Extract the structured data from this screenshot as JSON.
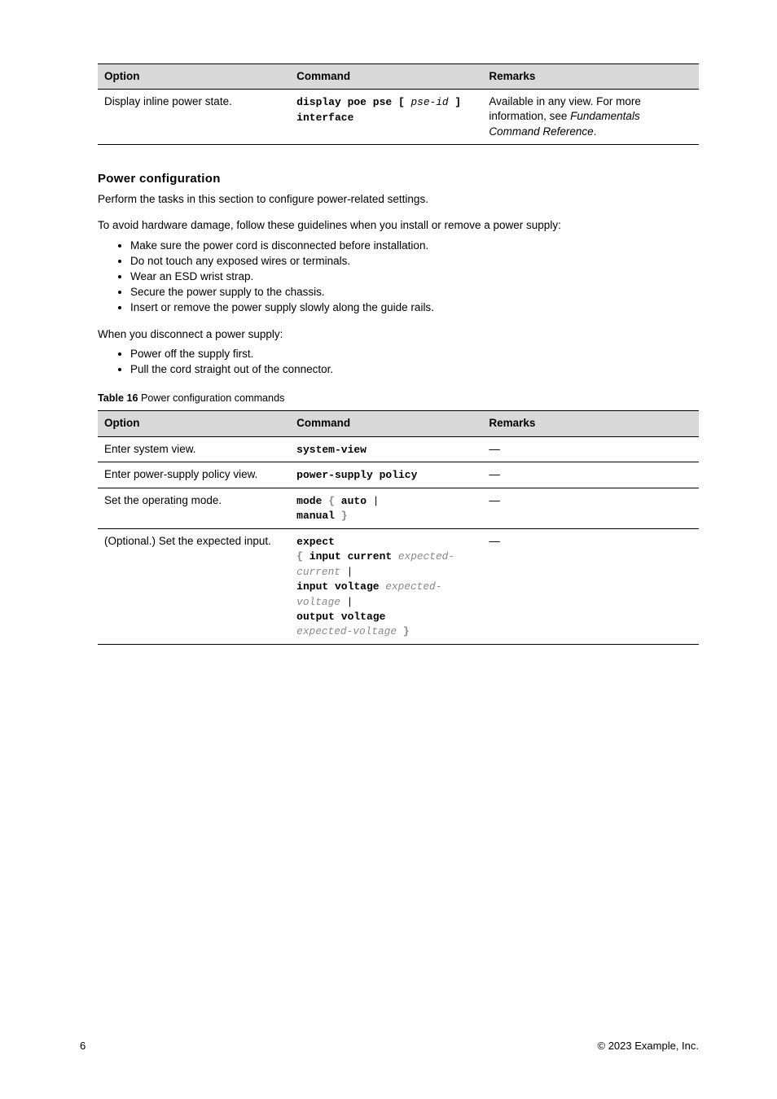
{
  "table1": {
    "headers": {
      "opt": "Option",
      "cmd": "Command",
      "rem": "Remarks"
    },
    "row": {
      "opt": "Display inline power state.",
      "cmd_pre": "display poe pse ",
      "cmd_b1": "[",
      "cmd_mid": " pse-id ",
      "cmd_b2": "]",
      "cmd_post": " interface",
      "rem_pre": "Available in any view. For more information, see ",
      "rem_it": "Fundamentals Command Reference",
      "rem_post": "."
    }
  },
  "section": {
    "heading": "Power configuration",
    "desc": "Perform the tasks in this section to configure power-related settings.",
    "sub1": "To avoid hardware damage, follow these guidelines when you install or remove a power supply:",
    "bullets1": [
      "Make sure the power cord is disconnected before installation.",
      "Do not touch any exposed wires or terminals.",
      "Wear an ESD wrist strap.",
      "Secure the power supply to the chassis.",
      "Insert or remove the power supply slowly along the guide rails."
    ],
    "sub2": "When you disconnect a power supply:",
    "bullets2": [
      "Power off the supply first.",
      "Pull the cord straight out of the connector."
    ]
  },
  "table2": {
    "caption_b": "Table 16",
    "caption_rest": " Power configuration commands",
    "headers": {
      "opt": "Option",
      "cmd": "Command",
      "rem": "Remarks"
    },
    "rows": [
      {
        "opt": "Enter system view.",
        "cmd": "system-view",
        "rem": "—"
      },
      {
        "opt": "Enter power-supply policy view.",
        "cmd": "power-supply policy",
        "rem": "—"
      },
      {
        "opt": "Set the operating mode.",
        "cmd_pre": "mode ",
        "cmd_b1": "{ ",
        "cmd_o1": "auto",
        "cmd_p1": " | ",
        "cmd_o2": "manual",
        "cmd_b2": " }",
        "rem": "—"
      },
      {
        "opt": "(Optional.) Set the expected input.",
        "cmd_pre": "expect",
        "cmd_ln2_pre": " ",
        "cmd_ln2_b1": "{ ",
        "cmd_ln2_a": "input current",
        "cmd_ln2_it1": " expected-current ",
        "cmd_ln2_p": "|",
        "cmd_ln3_a": " input voltage",
        "cmd_ln3_it": " expected-voltage",
        "cmd_ln3_p": " |",
        "cmd_ln4_a": " output voltage",
        "cmd_ln5_it": " expected-voltage ",
        "cmd_ln5_b2": "}",
        "rem": "—"
      }
    ]
  },
  "footer": {
    "left": "6",
    "right": "© 2023 Example, Inc."
  }
}
